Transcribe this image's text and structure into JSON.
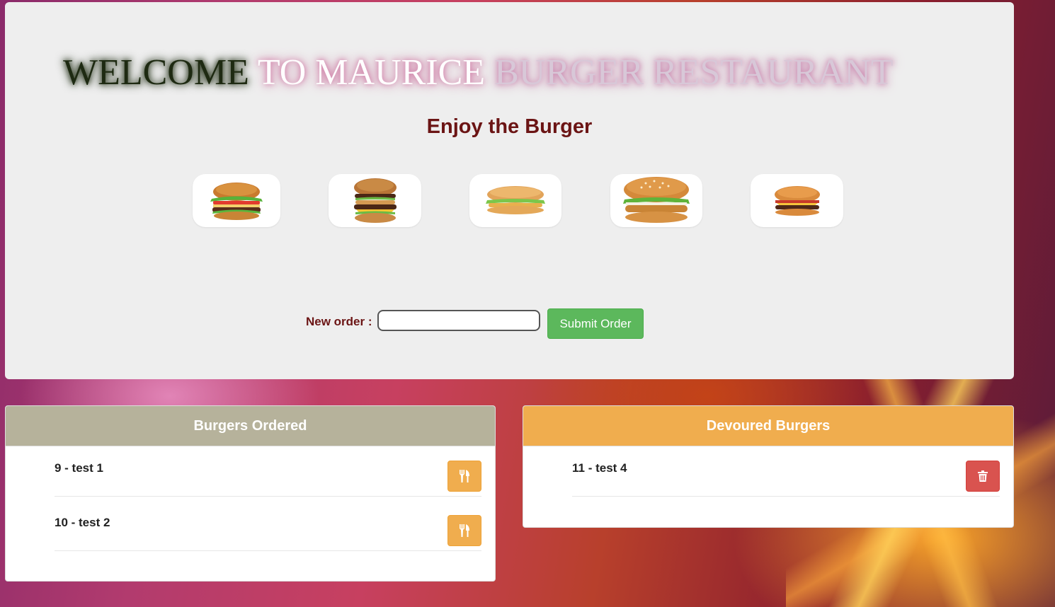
{
  "header": {
    "title_part1": "WELCOME",
    "title_part2": "TO MAURICE",
    "title_part3": "BURGER RESTAURANT",
    "subtitle": "Enjoy the Burger"
  },
  "burger_images": [
    {
      "name": "classic-burger"
    },
    {
      "name": "double-deck-burger"
    },
    {
      "name": "chicken-burger"
    },
    {
      "name": "sesame-chicken-burger"
    },
    {
      "name": "cheeseburger"
    }
  ],
  "order_form": {
    "label": "New order :",
    "input_value": "",
    "input_placeholder": "",
    "submit_label": "Submit Order"
  },
  "ordered_panel": {
    "title": "Burgers Ordered",
    "header_color": "#b6b29b",
    "items": [
      {
        "label": "9 - test 1",
        "action_icon": "utensils-icon"
      },
      {
        "label": "10 - test 2",
        "action_icon": "utensils-icon"
      }
    ]
  },
  "devoured_panel": {
    "title": "Devoured Burgers",
    "header_color": "#f0ad4e",
    "items": [
      {
        "label": "11 - test 4",
        "action_icon": "trash-icon"
      }
    ]
  }
}
